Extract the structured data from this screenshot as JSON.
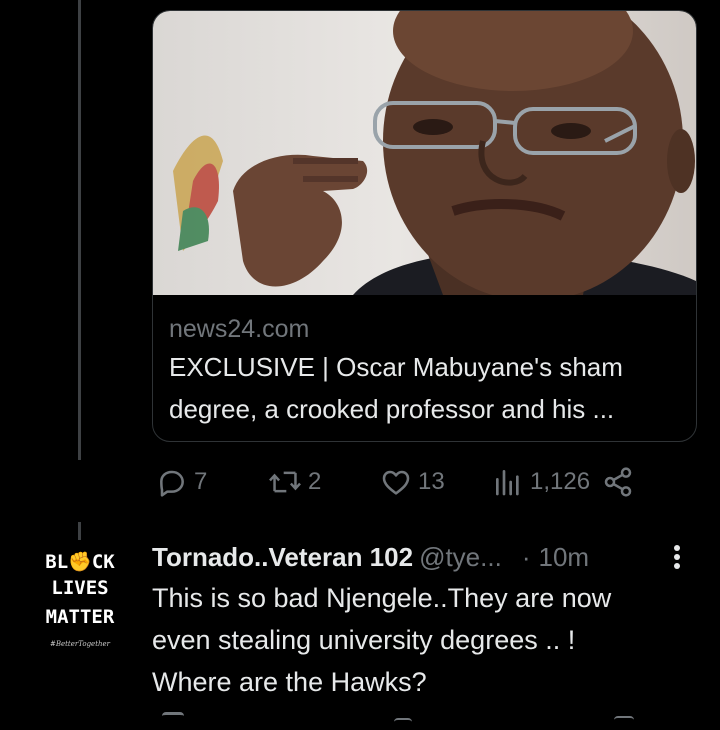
{
  "card": {
    "domain": "news24.com",
    "title_line1": "EXCLUSIVE | Oscar Mabuyane's sham",
    "title_line2": "degree, a crooked professor and his ..."
  },
  "actions": {
    "replies": "7",
    "retweets": "2",
    "likes": "13",
    "views": "1,126"
  },
  "reply": {
    "avatar_text": {
      "line1": "BL✊CK",
      "line2": "LIVES",
      "line3": "MATTER",
      "line4": "#BetterTogether"
    },
    "name": "Tornado..Veteran 102",
    "handle": "@tye...",
    "sep": "·",
    "time": "10m",
    "text_line1": "This is so bad Njengele..They are now",
    "text_line2": "even stealing university degrees .. !",
    "text_line3": "Where are the Hawks?"
  },
  "colors": {
    "background": "#000000",
    "text": "#e7e9ea",
    "muted": "#71767b",
    "border": "#2f3336"
  }
}
